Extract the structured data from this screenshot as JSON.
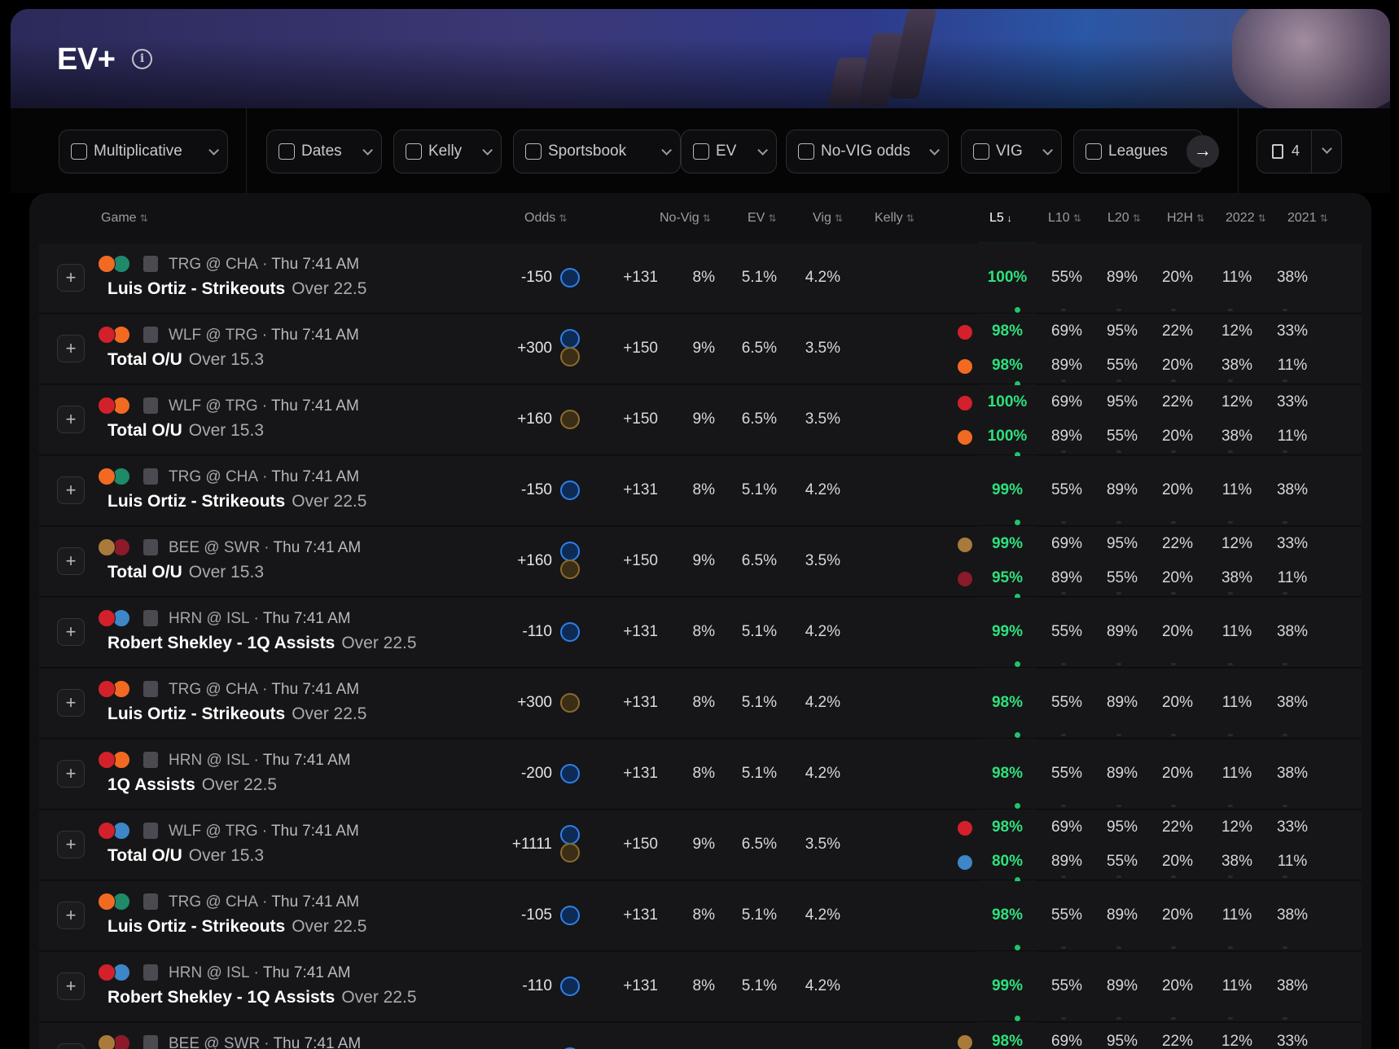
{
  "page": {
    "title": "EV+",
    "info_icon": "info-icon"
  },
  "filters": [
    {
      "label": "Multiplicative",
      "icon": "calculator-icon"
    },
    {
      "label": "Dates",
      "icon": "calendar-icon"
    },
    {
      "label": "Kelly",
      "icon": "sparkle-icon"
    },
    {
      "label": "Sportsbook",
      "icon": "store-icon"
    },
    {
      "label": "EV",
      "icon": "chart-icon"
    },
    {
      "label": "No-VIG odds",
      "icon": "tag-icon"
    },
    {
      "label": "VIG",
      "icon": "percent-icon"
    },
    {
      "label": "Leagues",
      "icon": "trophy-icon"
    }
  ],
  "scroll_arrow": "→",
  "bookmarks": {
    "count": "4",
    "icon": "bookmark-icon"
  },
  "columns": {
    "game": "Game",
    "odds": "Odds",
    "novig": "No-Vig",
    "ev": "EV",
    "vig": "Vig",
    "kelly": "Kelly",
    "l5": "L5",
    "l10": "L10",
    "l20": "L20",
    "h2h": "H2H",
    "y2022": "2022",
    "y2021": "2021"
  },
  "sort_icon": "⇅",
  "sort_active": "↓",
  "colors": {
    "accent": "#2ee07d",
    "shield": "#2f7fe6",
    "trophy": "#8a6a2e",
    "orange": "#f26a22",
    "teal": "#1f8a6a",
    "red": "#d3212b",
    "blue": "#3d86c8",
    "gold": "#a97a3a",
    "crimson": "#8b1a2b"
  },
  "rows": [
    {
      "matchup": "TRG @ CHA",
      "time": "Thu 7:41 AM",
      "player": "Luis Ortiz - Strikeouts",
      "line": "Over 22.5",
      "odds": "-150",
      "books": [
        "shield"
      ],
      "novig": "+131",
      "ev": "8%",
      "vig": "5.1%",
      "kelly": "4.2%",
      "teams": [
        "orange",
        "teal"
      ],
      "stats": [
        {
          "team": null,
          "l5": "100%",
          "l10": "55%",
          "l20": "89%",
          "h2h": "20%",
          "y2022": "11%",
          "y2021": "38%"
        }
      ]
    },
    {
      "matchup": "WLF @ TRG",
      "time": "Thu 7:41 AM",
      "player": "Total O/U",
      "line": "Over 15.3",
      "odds": "+300",
      "books": [
        "shield",
        "trophy"
      ],
      "novig": "+150",
      "ev": "9%",
      "vig": "6.5%",
      "kelly": "3.5%",
      "teams": [
        "red",
        "orange"
      ],
      "stats": [
        {
          "team": "red",
          "l5": "98%",
          "l10": "69%",
          "l20": "95%",
          "h2h": "22%",
          "y2022": "12%",
          "y2021": "33%"
        },
        {
          "team": "orange",
          "l5": "98%",
          "l10": "89%",
          "l20": "55%",
          "h2h": "20%",
          "y2022": "38%",
          "y2021": "11%"
        }
      ]
    },
    {
      "matchup": "WLF @ TRG",
      "time": "Thu 7:41 AM",
      "player": "Total O/U",
      "line": "Over 15.3",
      "odds": "+160",
      "books": [
        "trophy"
      ],
      "novig": "+150",
      "ev": "9%",
      "vig": "6.5%",
      "kelly": "3.5%",
      "teams": [
        "red",
        "orange"
      ],
      "stats": [
        {
          "team": "red",
          "l5": "100%",
          "l10": "69%",
          "l20": "95%",
          "h2h": "22%",
          "y2022": "12%",
          "y2021": "33%"
        },
        {
          "team": "orange",
          "l5": "100%",
          "l10": "89%",
          "l20": "55%",
          "h2h": "20%",
          "y2022": "38%",
          "y2021": "11%"
        }
      ]
    },
    {
      "matchup": "TRG @ CHA",
      "time": "Thu 7:41 AM",
      "player": "Luis Ortiz - Strikeouts",
      "line": "Over 22.5",
      "odds": "-150",
      "books": [
        "shield"
      ],
      "novig": "+131",
      "ev": "8%",
      "vig": "5.1%",
      "kelly": "4.2%",
      "teams": [
        "orange",
        "teal"
      ],
      "stats": [
        {
          "team": null,
          "l5": "99%",
          "l10": "55%",
          "l20": "89%",
          "h2h": "20%",
          "y2022": "11%",
          "y2021": "38%"
        }
      ]
    },
    {
      "matchup": "BEE @ SWR",
      "time": "Thu 7:41 AM",
      "player": "Total O/U",
      "line": "Over 15.3",
      "odds": "+160",
      "books": [
        "shield",
        "trophy"
      ],
      "novig": "+150",
      "ev": "9%",
      "vig": "6.5%",
      "kelly": "3.5%",
      "teams": [
        "gold",
        "crimson"
      ],
      "stats": [
        {
          "team": "gold",
          "l5": "99%",
          "l10": "69%",
          "l20": "95%",
          "h2h": "22%",
          "y2022": "12%",
          "y2021": "33%"
        },
        {
          "team": "crimson",
          "l5": "95%",
          "l10": "89%",
          "l20": "55%",
          "h2h": "20%",
          "y2022": "38%",
          "y2021": "11%"
        }
      ]
    },
    {
      "matchup": "HRN @ ISL",
      "time": "Thu 7:41 AM",
      "player": "Robert Shekley - 1Q Assists",
      "line": "Over 22.5",
      "odds": "-110",
      "books": [
        "shield"
      ],
      "novig": "+131",
      "ev": "8%",
      "vig": "5.1%",
      "kelly": "4.2%",
      "teams": [
        "red",
        "blue"
      ],
      "stats": [
        {
          "team": null,
          "l5": "99%",
          "l10": "55%",
          "l20": "89%",
          "h2h": "20%",
          "y2022": "11%",
          "y2021": "38%"
        }
      ]
    },
    {
      "matchup": "TRG @ CHA",
      "time": "Thu 7:41 AM",
      "player": "Luis Ortiz - Strikeouts",
      "line": "Over 22.5",
      "odds": "+300",
      "books": [
        "trophy"
      ],
      "novig": "+131",
      "ev": "8%",
      "vig": "5.1%",
      "kelly": "4.2%",
      "teams": [
        "red",
        "orange"
      ],
      "stats": [
        {
          "team": null,
          "l5": "98%",
          "l10": "55%",
          "l20": "89%",
          "h2h": "20%",
          "y2022": "11%",
          "y2021": "38%"
        }
      ]
    },
    {
      "matchup": "HRN @ ISL",
      "time": "Thu 7:41 AM",
      "player": "1Q Assists",
      "line": "Over 22.5",
      "odds": "-200",
      "books": [
        "shield"
      ],
      "novig": "+131",
      "ev": "8%",
      "vig": "5.1%",
      "kelly": "4.2%",
      "teams": [
        "red",
        "orange"
      ],
      "stats": [
        {
          "team": null,
          "l5": "98%",
          "l10": "55%",
          "l20": "89%",
          "h2h": "20%",
          "y2022": "11%",
          "y2021": "38%"
        }
      ]
    },
    {
      "matchup": "WLF @ TRG",
      "time": "Thu 7:41 AM",
      "player": "Total O/U",
      "line": "Over 15.3",
      "odds": "+1111",
      "books": [
        "shield",
        "trophy"
      ],
      "novig": "+150",
      "ev": "9%",
      "vig": "6.5%",
      "kelly": "3.5%",
      "teams": [
        "red",
        "blue"
      ],
      "stats": [
        {
          "team": "red",
          "l5": "98%",
          "l10": "69%",
          "l20": "95%",
          "h2h": "22%",
          "y2022": "12%",
          "y2021": "33%"
        },
        {
          "team": "blue",
          "l5": "80%",
          "l10": "89%",
          "l20": "55%",
          "h2h": "20%",
          "y2022": "38%",
          "y2021": "11%"
        }
      ]
    },
    {
      "matchup": "TRG @ CHA",
      "time": "Thu 7:41 AM",
      "player": "Luis Ortiz - Strikeouts",
      "line": "Over 22.5",
      "odds": "-105",
      "books": [
        "shield"
      ],
      "novig": "+131",
      "ev": "8%",
      "vig": "5.1%",
      "kelly": "4.2%",
      "teams": [
        "orange",
        "teal"
      ],
      "stats": [
        {
          "team": null,
          "l5": "98%",
          "l10": "55%",
          "l20": "89%",
          "h2h": "20%",
          "y2022": "11%",
          "y2021": "38%"
        }
      ]
    },
    {
      "matchup": "HRN @ ISL",
      "time": "Thu 7:41 AM",
      "player": "Robert Shekley - 1Q Assists",
      "line": "Over 22.5",
      "odds": "-110",
      "books": [
        "shield"
      ],
      "novig": "+131",
      "ev": "8%",
      "vig": "5.1%",
      "kelly": "4.2%",
      "teams": [
        "red",
        "blue"
      ],
      "stats": [
        {
          "team": null,
          "l5": "99%",
          "l10": "55%",
          "l20": "89%",
          "h2h": "20%",
          "y2022": "11%",
          "y2021": "38%"
        }
      ]
    },
    {
      "matchup": "BEE @ SWR",
      "time": "Thu 7:41 AM",
      "player": "",
      "line": "",
      "odds": "",
      "books": [
        "shield"
      ],
      "novig": "",
      "ev": "",
      "vig": "",
      "kelly": "",
      "teams": [
        "gold",
        "crimson"
      ],
      "stats": [
        {
          "team": "gold",
          "l5": "98%",
          "l10": "69%",
          "l20": "95%",
          "h2h": "22%",
          "y2022": "12%",
          "y2021": "33%"
        }
      ]
    }
  ]
}
